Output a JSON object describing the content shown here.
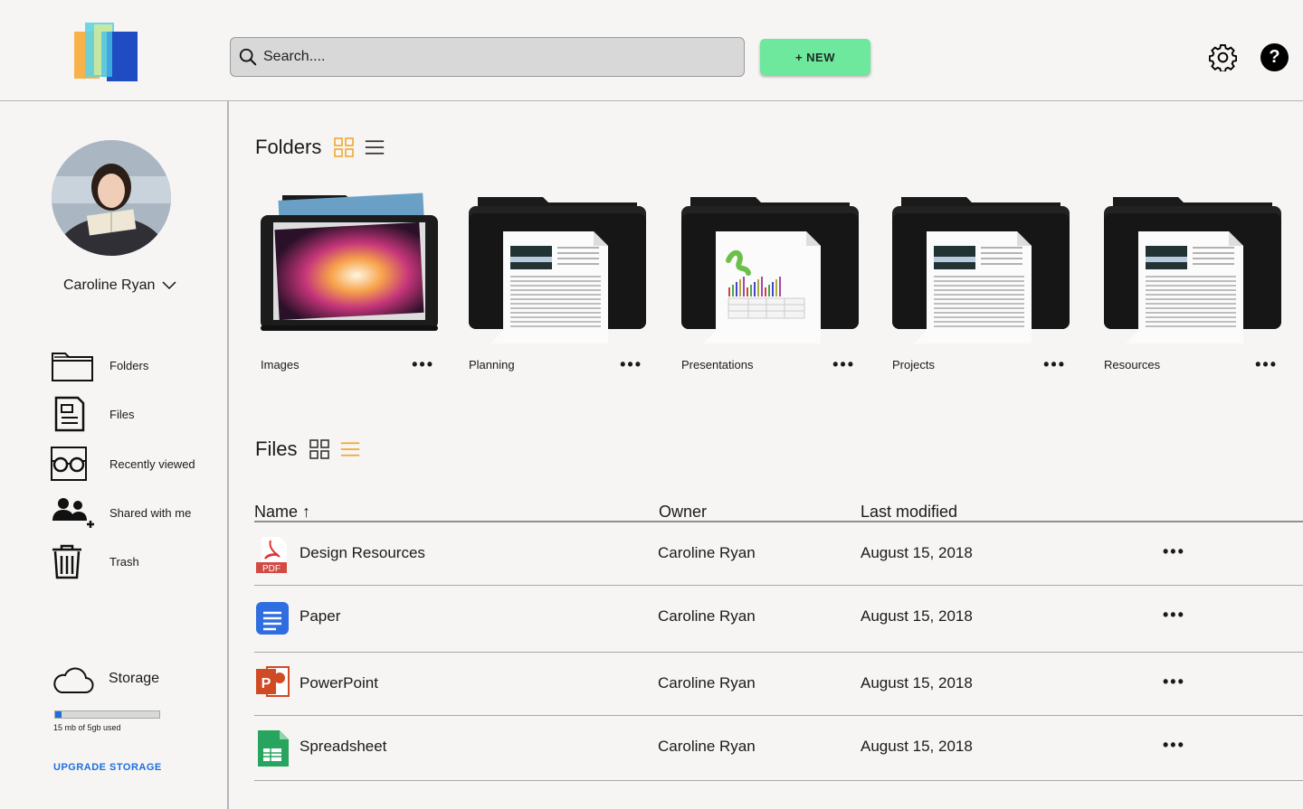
{
  "header": {
    "search_placeholder": "Search....",
    "new_label": "+ NEW",
    "help_glyph": "?"
  },
  "user": {
    "name": "Caroline Ryan"
  },
  "sidebar": {
    "items": [
      {
        "label": "Folders",
        "icon": "folder-icon"
      },
      {
        "label": "Files",
        "icon": "file-icon"
      },
      {
        "label": "Recently viewed",
        "icon": "glasses-icon"
      },
      {
        "label": "Shared with me",
        "icon": "shared-users-icon"
      },
      {
        "label": "Trash",
        "icon": "trash-icon"
      }
    ],
    "storage_label": "Storage",
    "storage_used": "15 mb of 5gb used",
    "storage_fraction": 0.003,
    "upgrade_label": "UPGRADE STORAGE"
  },
  "folders": {
    "title": "Folders",
    "items": [
      {
        "label": "Images"
      },
      {
        "label": "Planning"
      },
      {
        "label": "Presentations"
      },
      {
        "label": "Projects"
      },
      {
        "label": "Resources"
      }
    ]
  },
  "files": {
    "title": "Files",
    "columns": {
      "name": "Name",
      "sort_glyph": "↑",
      "owner": "Owner",
      "modified": "Last modified"
    },
    "rows": [
      {
        "name": "Design Resources",
        "type": "pdf",
        "owner": "Caroline Ryan",
        "modified": "August 15, 2018"
      },
      {
        "name": "Paper",
        "type": "doc",
        "owner": "Caroline Ryan",
        "modified": "August 15, 2018"
      },
      {
        "name": "PowerPoint",
        "type": "ppt",
        "owner": "Caroline Ryan",
        "modified": "August 15, 2018"
      },
      {
        "name": "Spreadsheet",
        "type": "sheet",
        "owner": "Caroline Ryan",
        "modified": "August 15, 2018"
      }
    ],
    "pdf_badge": "PDF",
    "ppt_badge": "P"
  },
  "more_glyph": "•••",
  "colors": {
    "accent_green": "#6ee89c",
    "link_blue": "#1e6fd9",
    "grid_active": "#f0a830"
  }
}
